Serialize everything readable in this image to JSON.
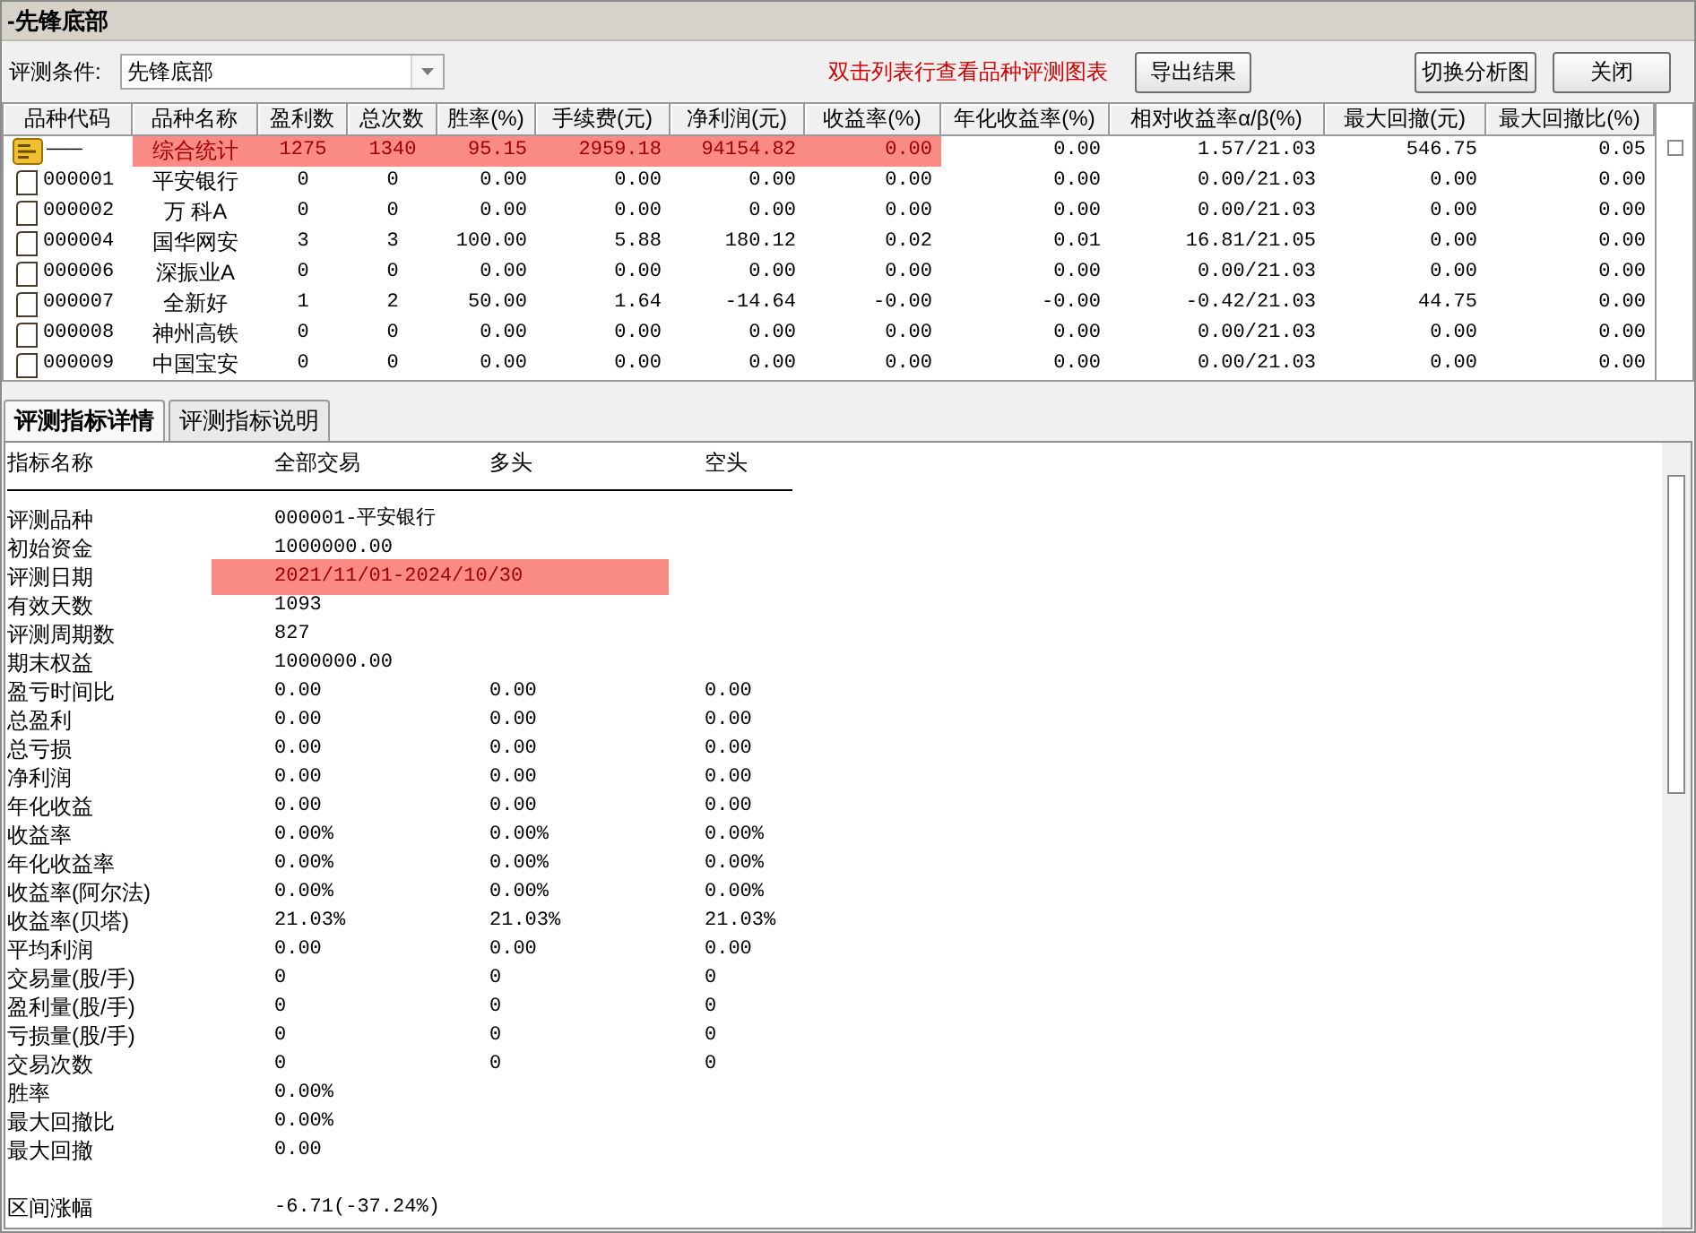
{
  "window": {
    "title": "-先锋底部"
  },
  "toolbar": {
    "condition_label": "评测条件:",
    "condition": {
      "value": "先锋底部"
    },
    "hint": "双击列表行查看品种评测图表",
    "buttons": [
      {
        "label": "导出结果"
      },
      {
        "label": "切换分析图"
      },
      {
        "label": "关闭"
      }
    ]
  },
  "table": {
    "columns": [
      "品种代码",
      "品种名称",
      "盈利数",
      "总次数",
      "胜率(%)",
      "手续费(元)",
      "净利润(元)",
      "收益率(%)",
      "年化收益率(%)",
      "相对收益率α/β(%)",
      "最大回撤(元)",
      "最大回撤比(%)"
    ],
    "rows": [
      {
        "kind": "summary",
        "highlighted": true,
        "cells": [
          "———",
          "综合统计",
          "1275",
          "1340",
          "95.15",
          "2959.18",
          "94154.82",
          "0.00",
          "0.00",
          "1.57/21.03",
          "546.75",
          "0.05"
        ]
      },
      {
        "kind": "stock",
        "highlighted": false,
        "cells": [
          "000001",
          "平安银行",
          "0",
          "0",
          "0.00",
          "0.00",
          "0.00",
          "0.00",
          "0.00",
          "0.00/21.03",
          "0.00",
          "0.00"
        ]
      },
      {
        "kind": "stock",
        "highlighted": false,
        "cells": [
          "000002",
          "万 科A",
          "0",
          "0",
          "0.00",
          "0.00",
          "0.00",
          "0.00",
          "0.00",
          "0.00/21.03",
          "0.00",
          "0.00"
        ]
      },
      {
        "kind": "stock",
        "highlighted": false,
        "cells": [
          "000004",
          "国华网安",
          "3",
          "3",
          "100.00",
          "5.88",
          "180.12",
          "0.02",
          "0.01",
          "16.81/21.05",
          "0.00",
          "0.00"
        ]
      },
      {
        "kind": "stock",
        "highlighted": false,
        "cells": [
          "000006",
          "深振业A",
          "0",
          "0",
          "0.00",
          "0.00",
          "0.00",
          "0.00",
          "0.00",
          "0.00/21.03",
          "0.00",
          "0.00"
        ]
      },
      {
        "kind": "stock",
        "highlighted": false,
        "cells": [
          "000007",
          "全新好",
          "1",
          "2",
          "50.00",
          "1.64",
          "-14.64",
          "-0.00",
          "-0.00",
          "-0.42/21.03",
          "44.75",
          "0.00"
        ]
      },
      {
        "kind": "stock",
        "highlighted": false,
        "cells": [
          "000008",
          "神州高铁",
          "0",
          "0",
          "0.00",
          "0.00",
          "0.00",
          "0.00",
          "0.00",
          "0.00/21.03",
          "0.00",
          "0.00"
        ]
      },
      {
        "kind": "stock",
        "highlighted": false,
        "cells": [
          "000009",
          "中国宝安",
          "0",
          "0",
          "0.00",
          "0.00",
          "0.00",
          "0.00",
          "0.00",
          "0.00/21.03",
          "0.00",
          "0.00"
        ]
      }
    ]
  },
  "details": {
    "tabs": [
      {
        "label": "评测指标详情",
        "selected": true
      },
      {
        "label": "评测指标说明",
        "selected": false
      }
    ],
    "columns": [
      "指标名称",
      "全部交易",
      "多头",
      "空头"
    ],
    "rows": [
      {
        "name": "评测品种",
        "highlighted": false,
        "values": [
          "000001-平安银行"
        ]
      },
      {
        "name": "初始资金",
        "highlighted": false,
        "values": [
          "1000000.00"
        ]
      },
      {
        "name": "评测日期",
        "highlighted": true,
        "values": [
          "2021/11/01-2024/10/30"
        ]
      },
      {
        "name": "有效天数",
        "highlighted": false,
        "values": [
          "1093"
        ]
      },
      {
        "name": "评测周期数",
        "highlighted": false,
        "values": [
          "827"
        ]
      },
      {
        "name": "期末权益",
        "highlighted": false,
        "values": [
          "1000000.00"
        ]
      },
      {
        "name": "盈亏时间比",
        "highlighted": false,
        "values": [
          "0.00",
          "0.00",
          "0.00"
        ]
      },
      {
        "name": "总盈利",
        "highlighted": false,
        "values": [
          "0.00",
          "0.00",
          "0.00"
        ]
      },
      {
        "name": "总亏损",
        "highlighted": false,
        "values": [
          "0.00",
          "0.00",
          "0.00"
        ]
      },
      {
        "name": "净利润",
        "highlighted": false,
        "values": [
          "0.00",
          "0.00",
          "0.00"
        ]
      },
      {
        "name": "年化收益",
        "highlighted": false,
        "values": [
          "0.00",
          "0.00",
          "0.00"
        ]
      },
      {
        "name": "收益率",
        "highlighted": false,
        "values": [
          "0.00%",
          "0.00%",
          "0.00%"
        ]
      },
      {
        "name": "年化收益率",
        "highlighted": false,
        "values": [
          "0.00%",
          "0.00%",
          "0.00%"
        ]
      },
      {
        "name": "收益率(阿尔法)",
        "highlighted": false,
        "values": [
          "0.00%",
          "0.00%",
          "0.00%"
        ]
      },
      {
        "name": "收益率(贝塔)",
        "highlighted": false,
        "values": [
          "21.03%",
          "21.03%",
          "21.03%"
        ]
      },
      {
        "name": "平均利润",
        "highlighted": false,
        "values": [
          "0.00",
          "0.00",
          "0.00"
        ]
      },
      {
        "name": "交易量(股/手)",
        "highlighted": false,
        "values": [
          "0",
          "0",
          "0"
        ]
      },
      {
        "name": "盈利量(股/手)",
        "highlighted": false,
        "values": [
          "0",
          "0",
          "0"
        ]
      },
      {
        "name": "亏损量(股/手)",
        "highlighted": false,
        "values": [
          "0",
          "0",
          "0"
        ]
      },
      {
        "name": "交易次数",
        "highlighted": false,
        "values": [
          "0",
          "0",
          "0"
        ]
      },
      {
        "name": "胜率",
        "highlighted": false,
        "values": [
          "0.00%"
        ]
      },
      {
        "name": "最大回撤比",
        "highlighted": false,
        "values": [
          "0.00%"
        ]
      },
      {
        "name": "最大回撤",
        "highlighted": false,
        "values": [
          "0.00"
        ]
      }
    ],
    "summary_rows": [
      {
        "name": "区间涨幅",
        "highlighted": false,
        "values": [
          "-6.71(-37.24%)"
        ]
      }
    ]
  }
}
